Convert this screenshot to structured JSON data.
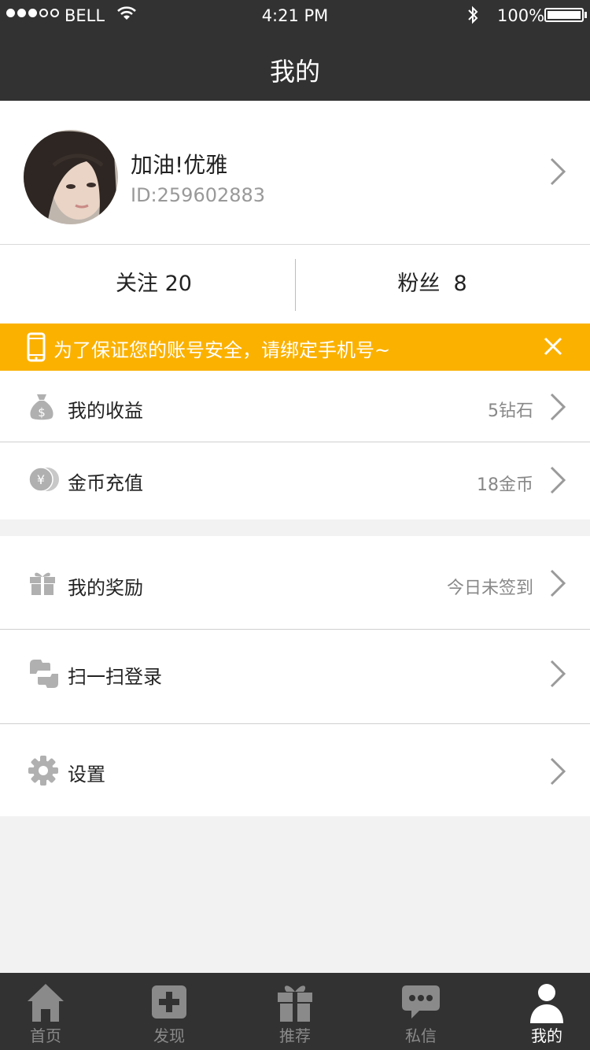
{
  "status_bar": {
    "carrier": "BELL",
    "time": "4:21 PM",
    "battery": "100%"
  },
  "nav": {
    "title": "我的"
  },
  "profile": {
    "nickname": "加油!优雅",
    "user_id": "ID:259602883"
  },
  "stats": {
    "following": "关注 20",
    "fans": "粉丝  8"
  },
  "banner": {
    "text": "为了保证您的账号安全，请绑定手机号~"
  },
  "menu": {
    "earnings": {
      "label": "我的收益",
      "value": "5钻石"
    },
    "recharge": {
      "label": "金币充值",
      "value": "18金币"
    },
    "rewards": {
      "label": "我的奖励",
      "value": "今日未签到"
    },
    "scan_login": {
      "label": "扫一扫登录"
    },
    "settings": {
      "label": "设置"
    }
  },
  "tabs": [
    {
      "label": "首页",
      "icon": "home-icon"
    },
    {
      "label": "发现",
      "icon": "plus-box-icon"
    },
    {
      "label": "推荐",
      "icon": "gift-icon"
    },
    {
      "label": "私信",
      "icon": "chat-bubble-icon"
    },
    {
      "label": "我的",
      "icon": "user-icon"
    }
  ],
  "colors": {
    "header": "#323232",
    "banner": "#fbb100",
    "background": "#f2f2f2"
  }
}
